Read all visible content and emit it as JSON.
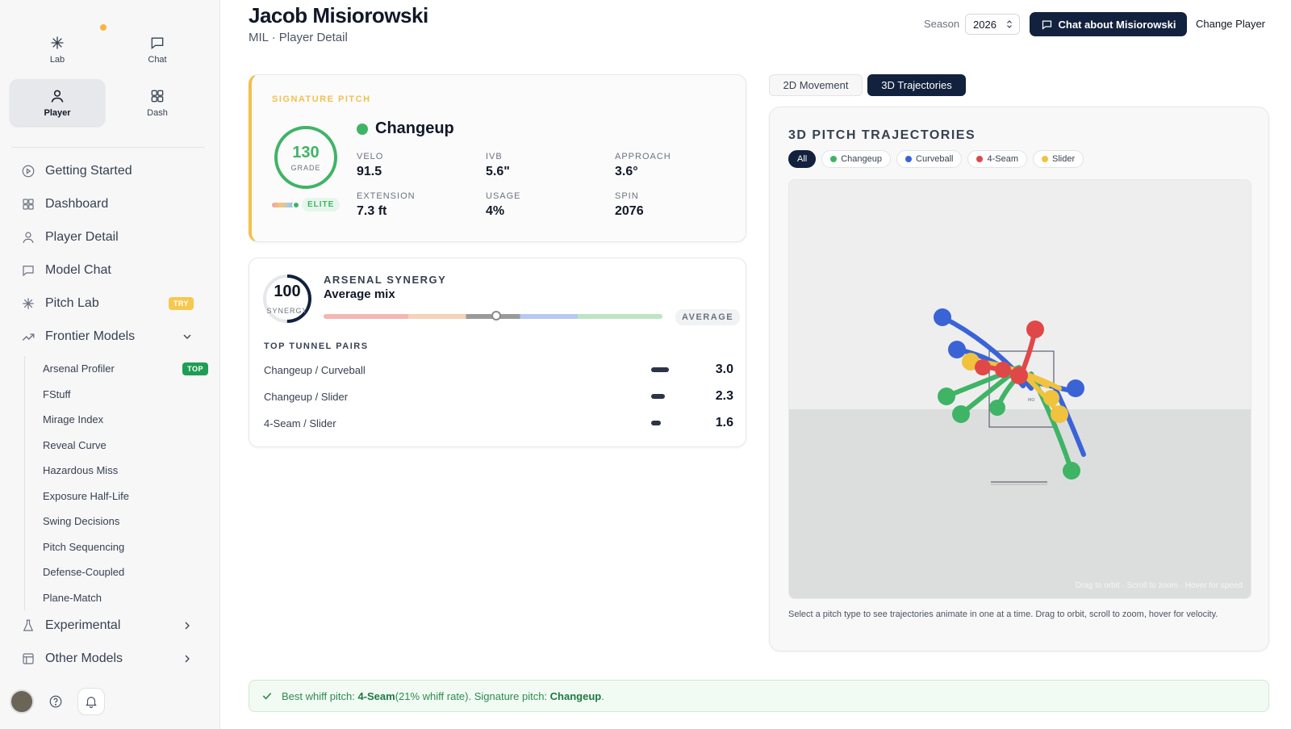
{
  "sidebar": {
    "modes": [
      {
        "label": "Lab",
        "icon": "sparkle-icon"
      },
      {
        "label": "Chat",
        "icon": "chat-bubble-icon"
      },
      {
        "label": "Player",
        "icon": "person-icon",
        "active": true
      },
      {
        "label": "Dash",
        "icon": "grid-icon"
      }
    ],
    "nav": [
      {
        "label": "Getting Started",
        "icon": "play-circle-icon"
      },
      {
        "label": "Dashboard",
        "icon": "grid-icon"
      },
      {
        "label": "Player Detail",
        "icon": "person-icon"
      },
      {
        "label": "Model Chat",
        "icon": "chat-bubble-icon"
      },
      {
        "label": "Pitch Lab",
        "icon": "sparkle-icon",
        "badge": "TRY"
      },
      {
        "label": "Frontier Models",
        "icon": "trend-icon",
        "expanded": true
      }
    ],
    "frontier_sub": [
      {
        "label": "Arsenal Profiler",
        "badge": "TOP"
      },
      {
        "label": "FStuff"
      },
      {
        "label": "Mirage Index"
      },
      {
        "label": "Reveal Curve"
      },
      {
        "label": "Hazardous Miss"
      },
      {
        "label": "Exposure Half-Life"
      },
      {
        "label": "Swing Decisions"
      },
      {
        "label": "Pitch Sequencing"
      },
      {
        "label": "Defense-Coupled"
      },
      {
        "label": "Plane-Match"
      }
    ],
    "nav_bottom": [
      {
        "label": "Experimental",
        "icon": "flask-icon"
      },
      {
        "label": "Other Models",
        "icon": "layout-icon"
      }
    ]
  },
  "header": {
    "player_name": "Jacob Misiorowski",
    "subtitle": "MIL · Player Detail",
    "season_label": "Season",
    "season_value": "2026",
    "chat_button": "Chat about Misiorowski",
    "change_button": "Change Player"
  },
  "signature": {
    "eyebrow": "SIGNATURE PITCH",
    "grade": "130",
    "grade_label": "GRADE",
    "tier": "ELITE",
    "pitch": "Changeup",
    "pitch_color": "#3fb465",
    "stats": [
      {
        "label": "VELO",
        "value": "91.5"
      },
      {
        "label": "IVB",
        "value": "5.6\""
      },
      {
        "label": "APPROACH",
        "value": "3.6°"
      },
      {
        "label": "EXTENSION",
        "value": "7.3 ft"
      },
      {
        "label": "USAGE",
        "value": "4%"
      },
      {
        "label": "SPIN",
        "value": "2076"
      }
    ]
  },
  "synergy": {
    "score": "100",
    "score_label": "SYNERGY",
    "eyebrow": "ARSENAL SYNERGY",
    "title": "Average mix",
    "badge": "AVERAGE",
    "slider_position": 0.51,
    "tunnel_heading": "TOP TUNNEL PAIRS",
    "tunnel_pairs": [
      {
        "name": "Changeup / Curveball",
        "value": "3.0"
      },
      {
        "name": "Changeup / Slider",
        "value": "2.3"
      },
      {
        "name": "4-Seam / Slider",
        "value": "1.6"
      }
    ]
  },
  "panel": {
    "tabs": [
      {
        "label": "2D Movement"
      },
      {
        "label": "3D Trajectories",
        "active": true
      }
    ],
    "title": "3D PITCH TRAJECTORIES",
    "chips": [
      {
        "label": "All",
        "active": true
      },
      {
        "label": "Changeup",
        "color": "#3fb465"
      },
      {
        "label": "Curveball",
        "color": "#3a63d6"
      },
      {
        "label": "4-Seam",
        "color": "#e04848"
      },
      {
        "label": "Slider",
        "color": "#f0c23e"
      }
    ],
    "viewport_hint": "Drag to orbit · Scroll to zoom · Hover for speed",
    "caption": "Select a pitch type to see trajectories animate in one at a time. Drag to orbit, scroll to zoom, hover for velocity."
  },
  "banner": {
    "prefix": "Best whiff pitch: ",
    "best_pitch": "4-Seam",
    "middle": " (21% whiff rate). Signature pitch: ",
    "signature_pitch": "Changeup",
    "suffix": "."
  }
}
